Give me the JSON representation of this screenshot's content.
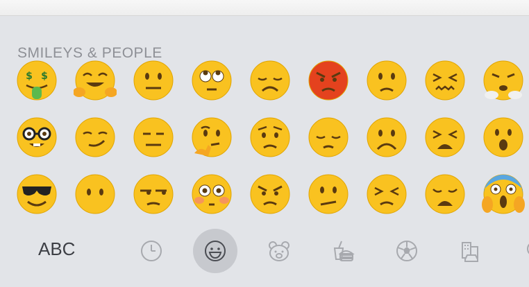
{
  "keyboard": {
    "section_title": "SMILEYS & PEOPLE",
    "abc_label": "ABC",
    "selected_category": "smileys-people",
    "emojis": [
      "money-mouth-face",
      "hugging-face",
      "neutral-face",
      "face-with-rolling-eyes",
      "disappointed-face",
      "pouting-face",
      "slightly-frowning-face",
      "confounded-face",
      "face-with-steam",
      "nerd-face",
      "smirking-face",
      "expressionless-face",
      "thinking-face",
      "worried-face",
      "pensive-face",
      "frowning-face",
      "tired-face",
      "face-with-open-mouth",
      "smiling-face-with-sunglasses",
      "face-without-mouth",
      "unamused-face",
      "flushed-face",
      "angry-face",
      "confused-face",
      "persevering-face",
      "weary-face",
      "face-screaming-in-fear"
    ],
    "categories": [
      "recents",
      "smileys-people",
      "animals-nature",
      "food-drink",
      "activity",
      "travel-places",
      "objects"
    ],
    "colors": {
      "face": "#f9c220",
      "angry": "#e4421e",
      "selected_pill": "#c7c9ce",
      "icon_gray": "#a7a9ae"
    }
  }
}
